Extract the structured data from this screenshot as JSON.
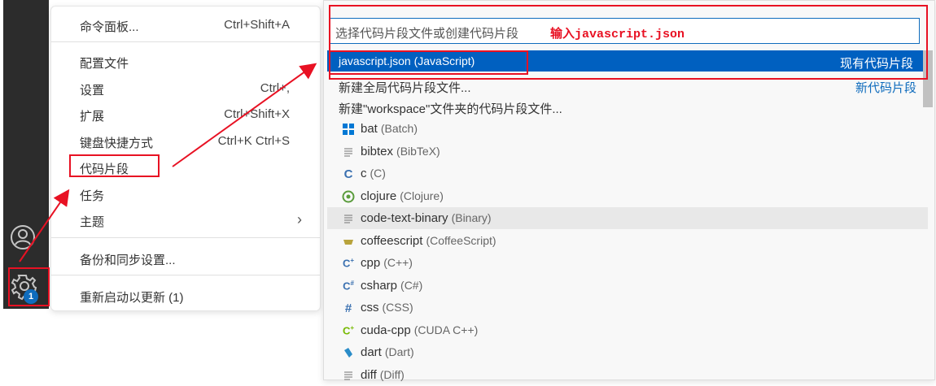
{
  "settings_menu": {
    "items": [
      {
        "label": "命令面板...",
        "shortcut": "Ctrl+Shift+A"
      },
      {
        "label": "配置文件",
        "shortcut": ""
      },
      {
        "label": "设置",
        "shortcut": "Ctrl+,"
      },
      {
        "label": "扩展",
        "shortcut": "Ctrl+Shift+X"
      },
      {
        "label": "键盘快捷方式",
        "shortcut": "Ctrl+K Ctrl+S"
      },
      {
        "label": "代码片段",
        "shortcut": ""
      },
      {
        "label": "任务",
        "shortcut": ""
      },
      {
        "label": "主题",
        "shortcut": ""
      },
      {
        "label": "备份和同步设置...",
        "shortcut": ""
      },
      {
        "label": "重新启动以更新 (1)",
        "shortcut": ""
      }
    ]
  },
  "activity_bar": {
    "account_icon": "account-icon",
    "gear_icon": "gear-icon",
    "badge_count": "1"
  },
  "quick_pick": {
    "placeholder": "选择代码片段文件或创建代码片段",
    "annotation_hint": "输入javascript.json",
    "selected": {
      "label": "javascript.json (JavaScript)",
      "group": "现有代码片段"
    },
    "new_global": "新建全局代码片段文件...",
    "new_group": "新代码片段",
    "new_workspace": "新建\"workspace\"文件夹的代码片段文件...",
    "languages": [
      {
        "name": "bat",
        "desc": "(Batch)",
        "icon": "windows-icon",
        "color": "#0078d4"
      },
      {
        "name": "bibtex",
        "desc": "(BibTeX)",
        "icon": "lines-icon",
        "color": "#888888"
      },
      {
        "name": "c",
        "desc": "(C)",
        "icon": "c-icon",
        "color": "#3a70b0"
      },
      {
        "name": "clojure",
        "desc": "(Clojure)",
        "icon": "clojure-icon",
        "color": "#5a9c3c"
      },
      {
        "name": "code-text-binary",
        "desc": "(Binary)",
        "icon": "lines-icon",
        "color": "#888888"
      },
      {
        "name": "coffeescript",
        "desc": "(CoffeeScript)",
        "icon": "coffee-icon",
        "color": "#b8a33c"
      },
      {
        "name": "cpp",
        "desc": "(C++)",
        "icon": "cpp-icon",
        "color": "#3a70b0"
      },
      {
        "name": "csharp",
        "desc": "(C#)",
        "icon": "csharp-icon",
        "color": "#3a70b0"
      },
      {
        "name": "css",
        "desc": "(CSS)",
        "icon": "hash-icon",
        "color": "#3a70b0"
      },
      {
        "name": "cuda-cpp",
        "desc": "(CUDA C++)",
        "icon": "cuda-icon",
        "color": "#76b900"
      },
      {
        "name": "dart",
        "desc": "(Dart)",
        "icon": "dart-icon",
        "color": "#2a8cc8"
      },
      {
        "name": "diff",
        "desc": "(Diff)",
        "icon": "lines-icon",
        "color": "#888888"
      }
    ]
  },
  "colors": {
    "accent": "#0060c0",
    "annotation": "#e81123",
    "activity_bg": "#2c2c2c"
  }
}
